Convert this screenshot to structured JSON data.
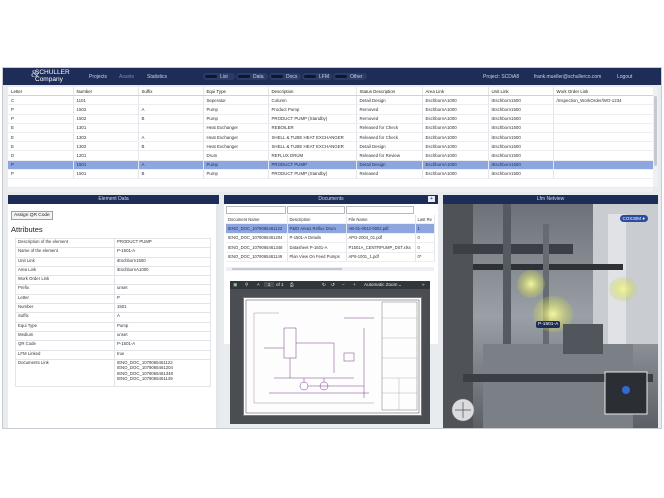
{
  "nav": {
    "logo_top": "SCHULLER",
    "logo_amp": "&",
    "logo_bottom": "Company",
    "links": [
      "Projects",
      "Assets",
      "Statistics"
    ],
    "toggles": [
      "List",
      "Data",
      "Docs",
      "LFM",
      "Other"
    ],
    "project": "Project: SCDiA8",
    "user": "frank.mueller@schullerco.com",
    "logout": "Logout"
  },
  "table": {
    "columns": [
      "Letter",
      "Number",
      "Suffix",
      "Equi Type",
      "Description",
      "Status Description",
      "Area Link",
      "Unit Link",
      "Work Order Link"
    ],
    "rows": [
      [
        "C",
        "1101",
        "",
        "Seperator",
        "Column",
        "Detail Design",
        "EschbornA1000",
        "iEschborn1500",
        "/Inspection_WorkOrder/WO-1234"
      ],
      [
        "P",
        "1502",
        "A",
        "Pump",
        "Product Pump",
        "Removed",
        "EschbornA1000",
        "iEschborn1500",
        ""
      ],
      [
        "P",
        "1502",
        "B",
        "Pump",
        "PRODUCT PUMP (Standby)",
        "Removed",
        "EschbornA1000",
        "iEschborn1500",
        ""
      ],
      [
        "E",
        "1301",
        "",
        "Heat Exchanger",
        "REBOILER",
        "Released for Check",
        "EschbornA1000",
        "iEschborn1500",
        ""
      ],
      [
        "E",
        "1302",
        "A",
        "Heat Exchanger",
        "SHELL & TUBE HEAT EXCHANGER",
        "Released for Check",
        "EschbornA1000",
        "iEschborn1500",
        ""
      ],
      [
        "E",
        "1302",
        "B",
        "Heat Exchanger",
        "SHELL & TUBE HEAT EXCHANGER",
        "Detail Design",
        "EschbornA1000",
        "iEschborn1500",
        ""
      ],
      [
        "D",
        "1201",
        "",
        "Drum",
        "REFLUX DRUM",
        "Released for Review",
        "EschbornA1000",
        "iEschborn1500",
        ""
      ],
      [
        "P",
        "1501",
        "A",
        "Pump",
        "PRODUCT PUMP",
        "Detail Design",
        "EschbornA1000",
        "iEschborn1500",
        ""
      ],
      [
        "P",
        "1501",
        "B",
        "Pump",
        "PRODUCT PUMP (Standby)",
        "Released",
        "EschbornA1000",
        "iEschborn1500",
        ""
      ]
    ],
    "selected_row": 7
  },
  "element_panel": {
    "title": "Element Data",
    "assign_qr": "Assign QR Code",
    "attributes_title": "Attributes",
    "attributes": [
      [
        "Description of the element",
        "PRODUCT PUMP"
      ],
      [
        "Name of the element",
        "P-1501-A"
      ],
      [
        "Unit Link",
        "iEschborn1500"
      ],
      [
        "Area Link",
        "iEschbornA1000"
      ],
      [
        "Work Order Link",
        ""
      ],
      [
        "Prefix",
        "unset"
      ],
      [
        "Letter",
        "P"
      ],
      [
        "Number",
        "1501"
      ],
      [
        "Suffix",
        "A"
      ],
      [
        "Equi Type",
        "Pump"
      ],
      [
        "Medium",
        "unset"
      ],
      [
        "QR Code",
        "P-1501-A"
      ],
      [
        "LFM Linked",
        "true"
      ]
    ],
    "documents_link_label": "Documents Link",
    "documents_link_values": [
      "IENO_DOC_1079065461122",
      "IENO_DOC_1079065461204",
      "IENO_DOC_1079065461348",
      "IENO_DOC_1079065461149"
    ]
  },
  "documents_panel": {
    "title": "Documents",
    "columns": [
      "Document Name",
      "Description",
      "File Name",
      "Last Re"
    ],
    "rows": [
      [
        "IENO_DOC_1079065461122",
        "P&ID Area1 Reflux Drum",
        "AB-01-0012-0002.pdf",
        "1"
      ],
      [
        "IENO_DOC_1079065461204",
        "P-1501-A Details",
        "APG-2004_01.pdf",
        "0"
      ],
      [
        "IENO_DOC_1079065461348",
        "Datasheet P-1501-A",
        "P1501A_CENTRPUMP_DST.xlsx",
        "0"
      ],
      [
        "IENO_DOC_1079065461149",
        "Plan View On Feed Pumps",
        "AP6-1001_1.pdf",
        "0*"
      ]
    ],
    "selected_row": 0,
    "pdf_toolbar": {
      "page": "1",
      "of": "of 1",
      "zoom": "Automatic Zoom",
      "minus": "−",
      "plus": "+"
    }
  },
  "lfm_panel": {
    "title": "Lfm Netview",
    "cox_button": "COX30M",
    "tag_label": "P-1501-A"
  },
  "colors": {
    "nav": "#1e2d57",
    "selection": "#8ea6e0",
    "panel_bg": "#ffffff"
  }
}
